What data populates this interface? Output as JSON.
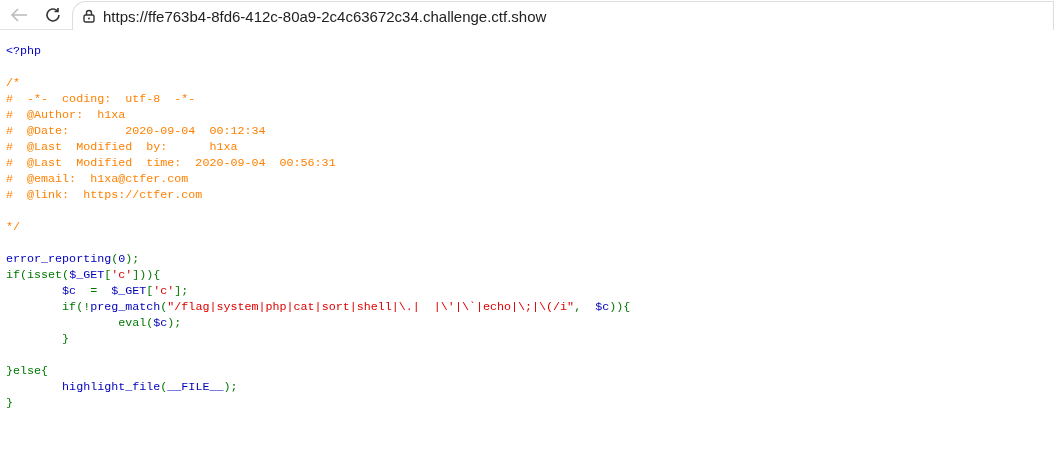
{
  "browser": {
    "url": "https://ffe763b4-8fd6-412c-80a9-2c4c63672c34.challenge.ctf.show"
  },
  "code": {
    "lines": [
      {
        "tokens": [
          {
            "kind": "default",
            "text": "<?php"
          }
        ]
      },
      {
        "kind": "blank"
      },
      {
        "tokens": [
          {
            "kind": "comment",
            "text": "/*"
          }
        ]
      },
      {
        "tokens": [
          {
            "kind": "comment",
            "text": "#  -*-  coding:  utf-8  -*-"
          }
        ]
      },
      {
        "tokens": [
          {
            "kind": "comment",
            "text": "#  @Author:  h1xa"
          }
        ]
      },
      {
        "tokens": [
          {
            "kind": "comment",
            "text": "#  @Date:        2020-09-04  00:12:34"
          }
        ]
      },
      {
        "tokens": [
          {
            "kind": "comment",
            "text": "#  @Last  Modified  by:      h1xa"
          }
        ]
      },
      {
        "tokens": [
          {
            "kind": "comment",
            "text": "#  @Last  Modified  time:  2020-09-04  00:56:31"
          }
        ]
      },
      {
        "tokens": [
          {
            "kind": "comment",
            "text": "#  @email:  h1xa@ctfer.com"
          }
        ]
      },
      {
        "tokens": [
          {
            "kind": "comment",
            "text": "#  @link:  https://ctfer.com"
          }
        ]
      },
      {
        "kind": "blank"
      },
      {
        "tokens": [
          {
            "kind": "comment",
            "text": "*/"
          }
        ]
      },
      {
        "kind": "blank"
      },
      {
        "tokens": [
          {
            "kind": "default",
            "text": "error_reporting"
          },
          {
            "kind": "keyword",
            "text": "("
          },
          {
            "kind": "default",
            "text": "0"
          },
          {
            "kind": "keyword",
            "text": ");"
          }
        ]
      },
      {
        "tokens": [
          {
            "kind": "keyword",
            "text": "if(isset("
          },
          {
            "kind": "default",
            "text": "$_GET"
          },
          {
            "kind": "keyword",
            "text": "["
          },
          {
            "kind": "string",
            "text": "'c'"
          },
          {
            "kind": "keyword",
            "text": "])){"
          }
        ]
      },
      {
        "tokens": [
          {
            "kind": "default",
            "text": "        $c"
          },
          {
            "kind": "keyword",
            "text": "  =  "
          },
          {
            "kind": "default",
            "text": "$_GET"
          },
          {
            "kind": "keyword",
            "text": "["
          },
          {
            "kind": "string",
            "text": "'c'"
          },
          {
            "kind": "keyword",
            "text": "];"
          }
        ]
      },
      {
        "tokens": [
          {
            "kind": "keyword",
            "text": "        if(!"
          },
          {
            "kind": "default",
            "text": "preg_match"
          },
          {
            "kind": "keyword",
            "text": "("
          },
          {
            "kind": "string",
            "text": "\"/flag|system|php|cat|sort|shell|\\.|  |\\'|\\`|echo|\\;|\\(/i\""
          },
          {
            "kind": "keyword",
            "text": ",  "
          },
          {
            "kind": "default",
            "text": "$c"
          },
          {
            "kind": "keyword",
            "text": ")){"
          }
        ]
      },
      {
        "tokens": [
          {
            "kind": "keyword",
            "text": "                eval("
          },
          {
            "kind": "default",
            "text": "$c"
          },
          {
            "kind": "keyword",
            "text": ");"
          }
        ]
      },
      {
        "tokens": [
          {
            "kind": "keyword",
            "text": "        }"
          }
        ]
      },
      {
        "kind": "blank"
      },
      {
        "tokens": [
          {
            "kind": "keyword",
            "text": "}else{"
          }
        ]
      },
      {
        "tokens": [
          {
            "kind": "default",
            "text": "        highlight_file"
          },
          {
            "kind": "keyword",
            "text": "("
          },
          {
            "kind": "default",
            "text": "__FILE__"
          },
          {
            "kind": "keyword",
            "text": ");"
          }
        ]
      },
      {
        "tokens": [
          {
            "kind": "keyword",
            "text": "}"
          }
        ]
      }
    ]
  }
}
